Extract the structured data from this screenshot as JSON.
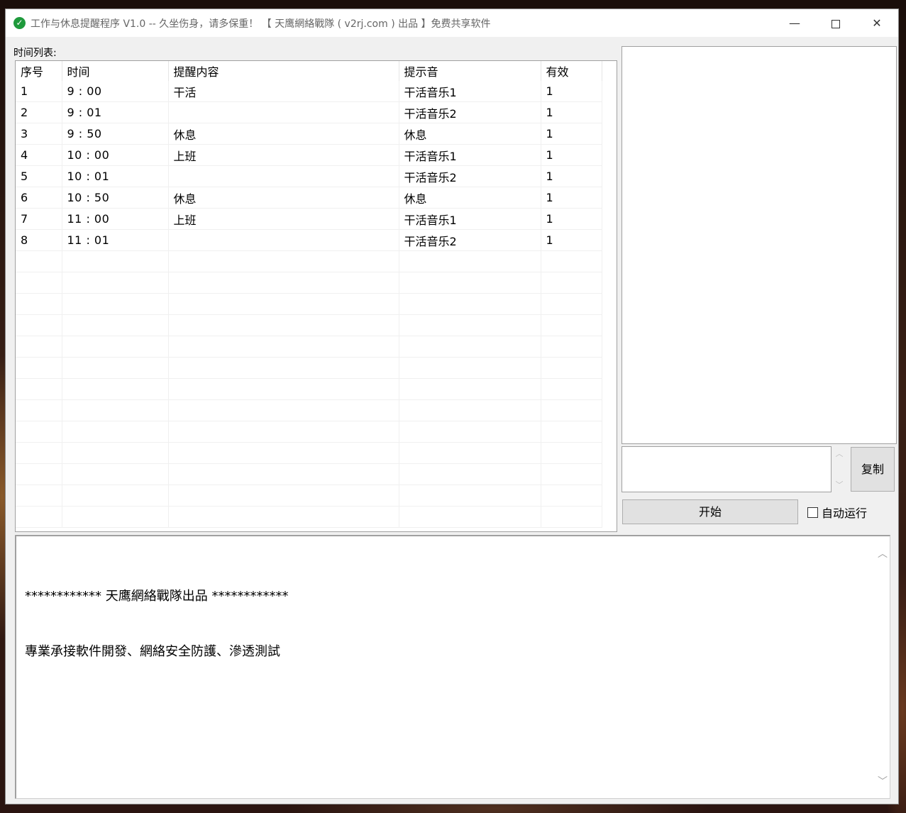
{
  "window": {
    "title": "工作与休息提醒程序 V1.0 -- 久坐伤身，请多保重！ 【 天鹰網絡戰隊 ( v2rj.com ) 出品 】免费共享软件",
    "icon": "check-circle-icon"
  },
  "list": {
    "label": "时间列表:",
    "columns": [
      "序号",
      "时间",
      "提醒内容",
      "提示音",
      "有效"
    ],
    "rows": [
      [
        "1",
        "9 : 00",
        "干活",
        "干活音乐1",
        "1"
      ],
      [
        "2",
        "9 : 01",
        "",
        "干活音乐2",
        "1"
      ],
      [
        "3",
        "9 : 50",
        "休息",
        "休息",
        "1"
      ],
      [
        "4",
        "10 : 00",
        "上班",
        "干活音乐1",
        "1"
      ],
      [
        "5",
        "10 : 01",
        "",
        "干活音乐2",
        "1"
      ],
      [
        "6",
        "10 : 50",
        "休息",
        "休息",
        "1"
      ],
      [
        "7",
        "11 : 00",
        "上班",
        "干活音乐1",
        "1"
      ],
      [
        "8",
        "11 : 01",
        "",
        "干活音乐2",
        "1"
      ],
      [
        "",
        "",
        "",
        "",
        ""
      ],
      [
        "",
        "",
        "",
        "",
        ""
      ],
      [
        "",
        "",
        "",
        "",
        ""
      ],
      [
        "",
        "",
        "",
        "",
        ""
      ],
      [
        "",
        "",
        "",
        "",
        ""
      ],
      [
        "",
        "",
        "",
        "",
        ""
      ],
      [
        "",
        "",
        "",
        "",
        ""
      ],
      [
        "",
        "",
        "",
        "",
        ""
      ],
      [
        "",
        "",
        "",
        "",
        ""
      ],
      [
        "",
        "",
        "",
        "",
        ""
      ],
      [
        "",
        "",
        "",
        "",
        ""
      ],
      [
        "",
        "",
        "",
        "",
        ""
      ],
      [
        "",
        "",
        "",
        "",
        ""
      ]
    ]
  },
  "controls": {
    "copy_label": "复制",
    "start_label": "开始",
    "auto_run_label": "自动运行",
    "auto_run_checked": false
  },
  "log": {
    "lines": [
      "************ 天鹰網絡戰隊出品 ************",
      "專業承接軟件開發、網絡安全防護、滲透測試"
    ]
  }
}
